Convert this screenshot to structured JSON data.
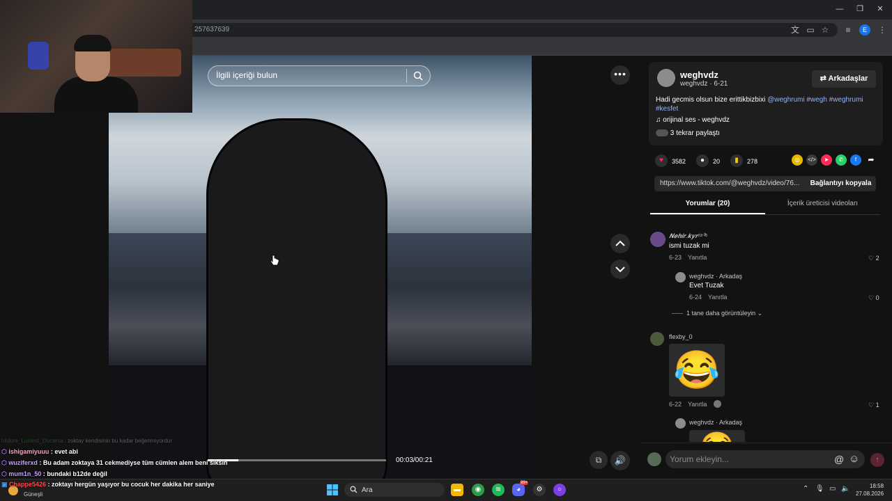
{
  "browser": {
    "url_fragment": "257637639",
    "icons": [
      "translate-icon",
      "cast-icon",
      "star-icon",
      "media-icon",
      "profile-icon",
      "menu-icon"
    ],
    "profile_initial": "E"
  },
  "video": {
    "search_placeholder": "İlgili içeriği bulun",
    "time": "00:03/00:21",
    "progress": 0.17
  },
  "post": {
    "author": "weghvdz",
    "author_sub": "weghvdz · 6-21",
    "friends_button": "Arkadaşlar",
    "caption_text": "Hadi gecmis olsun bize erittikbizbixi ",
    "caption_tags_1": "@weghrumi #wegh #weghrumi",
    "caption_tags_2": "#kesfet",
    "sound": "orijinal ses - weghvdz",
    "reposts": "3 tekrar paylaştı",
    "likes": "3582",
    "comments": "20",
    "saves": "278",
    "link": "https://www.tiktok.com/@weghvdz/video/76...",
    "copy_link": "Bağlantıyı kopyala"
  },
  "tabs": {
    "comments": "Yorumlar (20)",
    "creator_videos": "İçerik üreticisi videoları"
  },
  "comments": [
    {
      "user": "𝑵𝒆𝒉𝒊𝒓.𝒌𝒚𝒓¹⁹⁰⁵",
      "text": "ismi tuzak mi",
      "date": "6-23",
      "reply": "Yanıtla",
      "likes": "2"
    },
    {
      "user": "weghvdz · Arkadaş",
      "text": "Evet Tuzak",
      "date": "6-24",
      "reply": "Yanıtla",
      "likes": "0"
    },
    {
      "more": "1 tane daha görüntüleyin"
    },
    {
      "user": "flexby_0",
      "text": "😂",
      "date": "6-22",
      "reply": "Yanıtla",
      "likes": "1"
    },
    {
      "user": "weghvdz · Arkadaş",
      "text": "😂"
    }
  ],
  "comment_box": {
    "placeholder": "Yorum ekleyin..."
  },
  "chat": [
    {
      "user": "hildore_Loniest_Docarsa",
      "text": " : zoktay kendisinin bu kadar beğenmiyordur",
      "color": "#3b7a3b"
    },
    {
      "user": "ishigamiyuuu",
      "text": " : evet abi",
      "color": "#ff9ec8"
    },
    {
      "user": "wuziferxd",
      "text": " : Bu adam zoktaya 31 cekmediyse tüm cümlen alem beni siksin",
      "color": "#c59cff"
    },
    {
      "user": "mum1n_50",
      "text": " : bundaki b12de değil",
      "color": "#c59cff"
    },
    {
      "user": "Chappe5426",
      "text": " : zoktayı hergün yaşıyor bu cocuk her dakika her saniye",
      "color": "#ff4a4a"
    },
    {
      "user": "Güneşli",
      "text": "",
      "color": "#ffffff"
    }
  ],
  "taskbar": {
    "search": "Ara",
    "time": "18:58",
    "date": "27.08.2026",
    "discord_badge": "99+"
  }
}
